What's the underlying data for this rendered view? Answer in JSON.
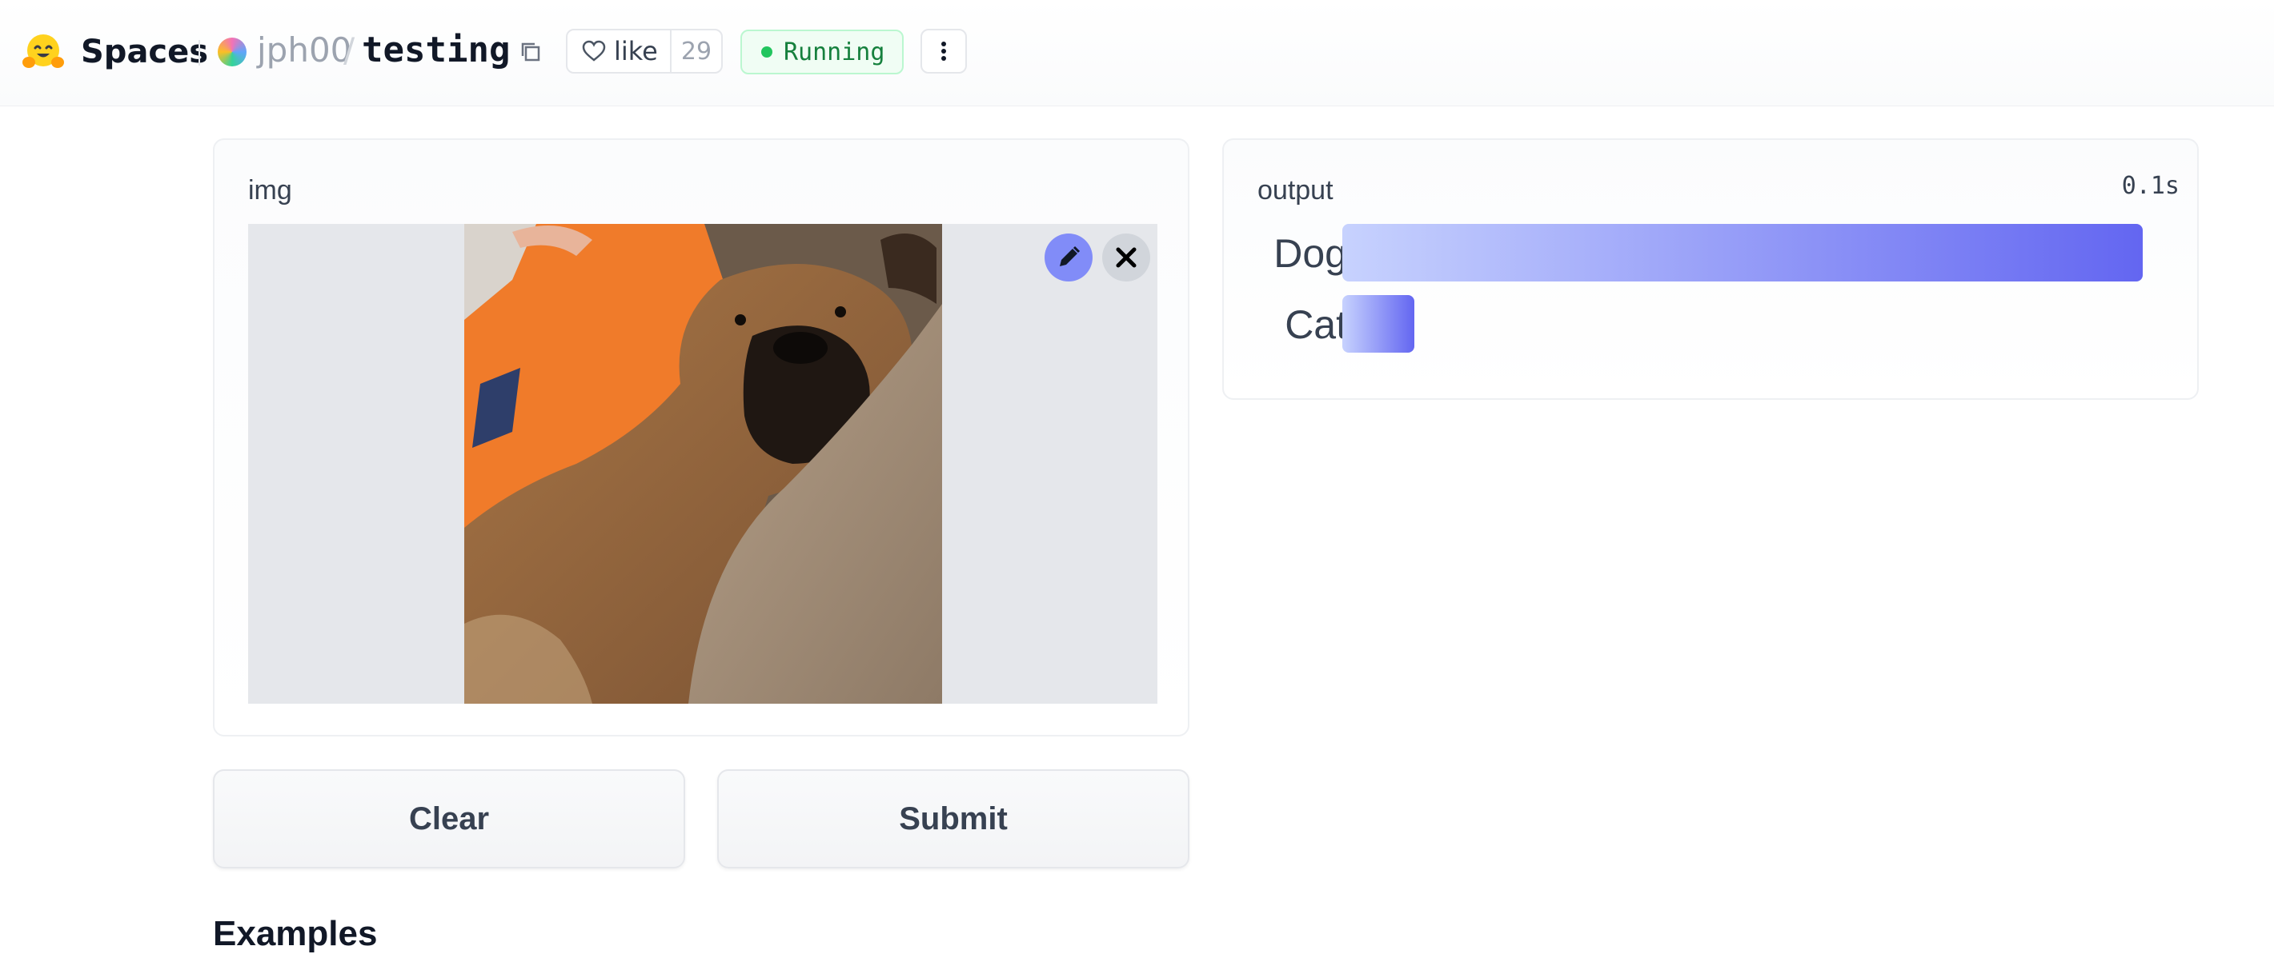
{
  "header": {
    "brand": "Spaces",
    "brand_icon": "hugging-face-emoji",
    "owner": "jph00",
    "separator": "/",
    "repo": "testing",
    "like_label": "like",
    "like_count": "29",
    "status": "Running",
    "status_color": "#22c55e"
  },
  "input": {
    "label": "img",
    "image_description_icons": [
      "edit-icon",
      "close-icon"
    ]
  },
  "output": {
    "label": "output",
    "timer": "0.1s",
    "accent": "#6366f1",
    "labels": [
      {
        "name": "Dog",
        "confidence": 1.0
      },
      {
        "name": "Cat",
        "confidence": 0.09
      }
    ]
  },
  "buttons": {
    "clear": "Clear",
    "submit": "Submit"
  },
  "examples": {
    "heading": "Examples"
  }
}
